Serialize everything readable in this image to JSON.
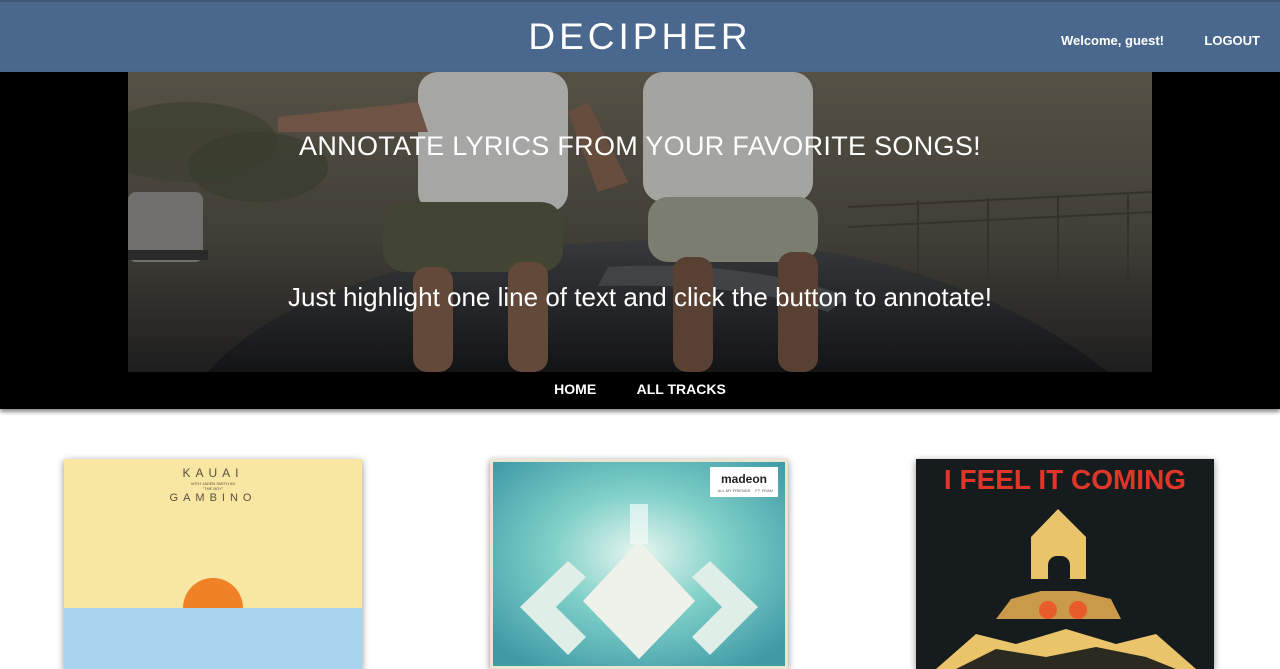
{
  "header": {
    "brand": "DECIPHER",
    "welcome": "Welcome, guest!",
    "logout": "LOGOUT"
  },
  "hero": {
    "title": "ANNOTATE LYRICS FROM YOUR FAVORITE SONGS!",
    "subtitle": "Just highlight one line of text and click the button to annotate!"
  },
  "nav": {
    "items": [
      {
        "label": "HOME"
      },
      {
        "label": "ALL TRACKS"
      }
    ]
  },
  "albums": [
    {
      "line1": "KAUAI",
      "line2": "WITH JADEN SMITH AS",
      "line3": "\"THE BOY\"",
      "line4": "GAMBINO"
    },
    {
      "logo": "madeon",
      "sub1": "ALL MY FRIENDS",
      "sub2": "FT. RYAN"
    },
    {
      "title": "I FEEL IT COMING"
    }
  ],
  "colors": {
    "header_bg": "#4a678e",
    "band_bg": "#000000",
    "album3_title": "#e0362a"
  }
}
